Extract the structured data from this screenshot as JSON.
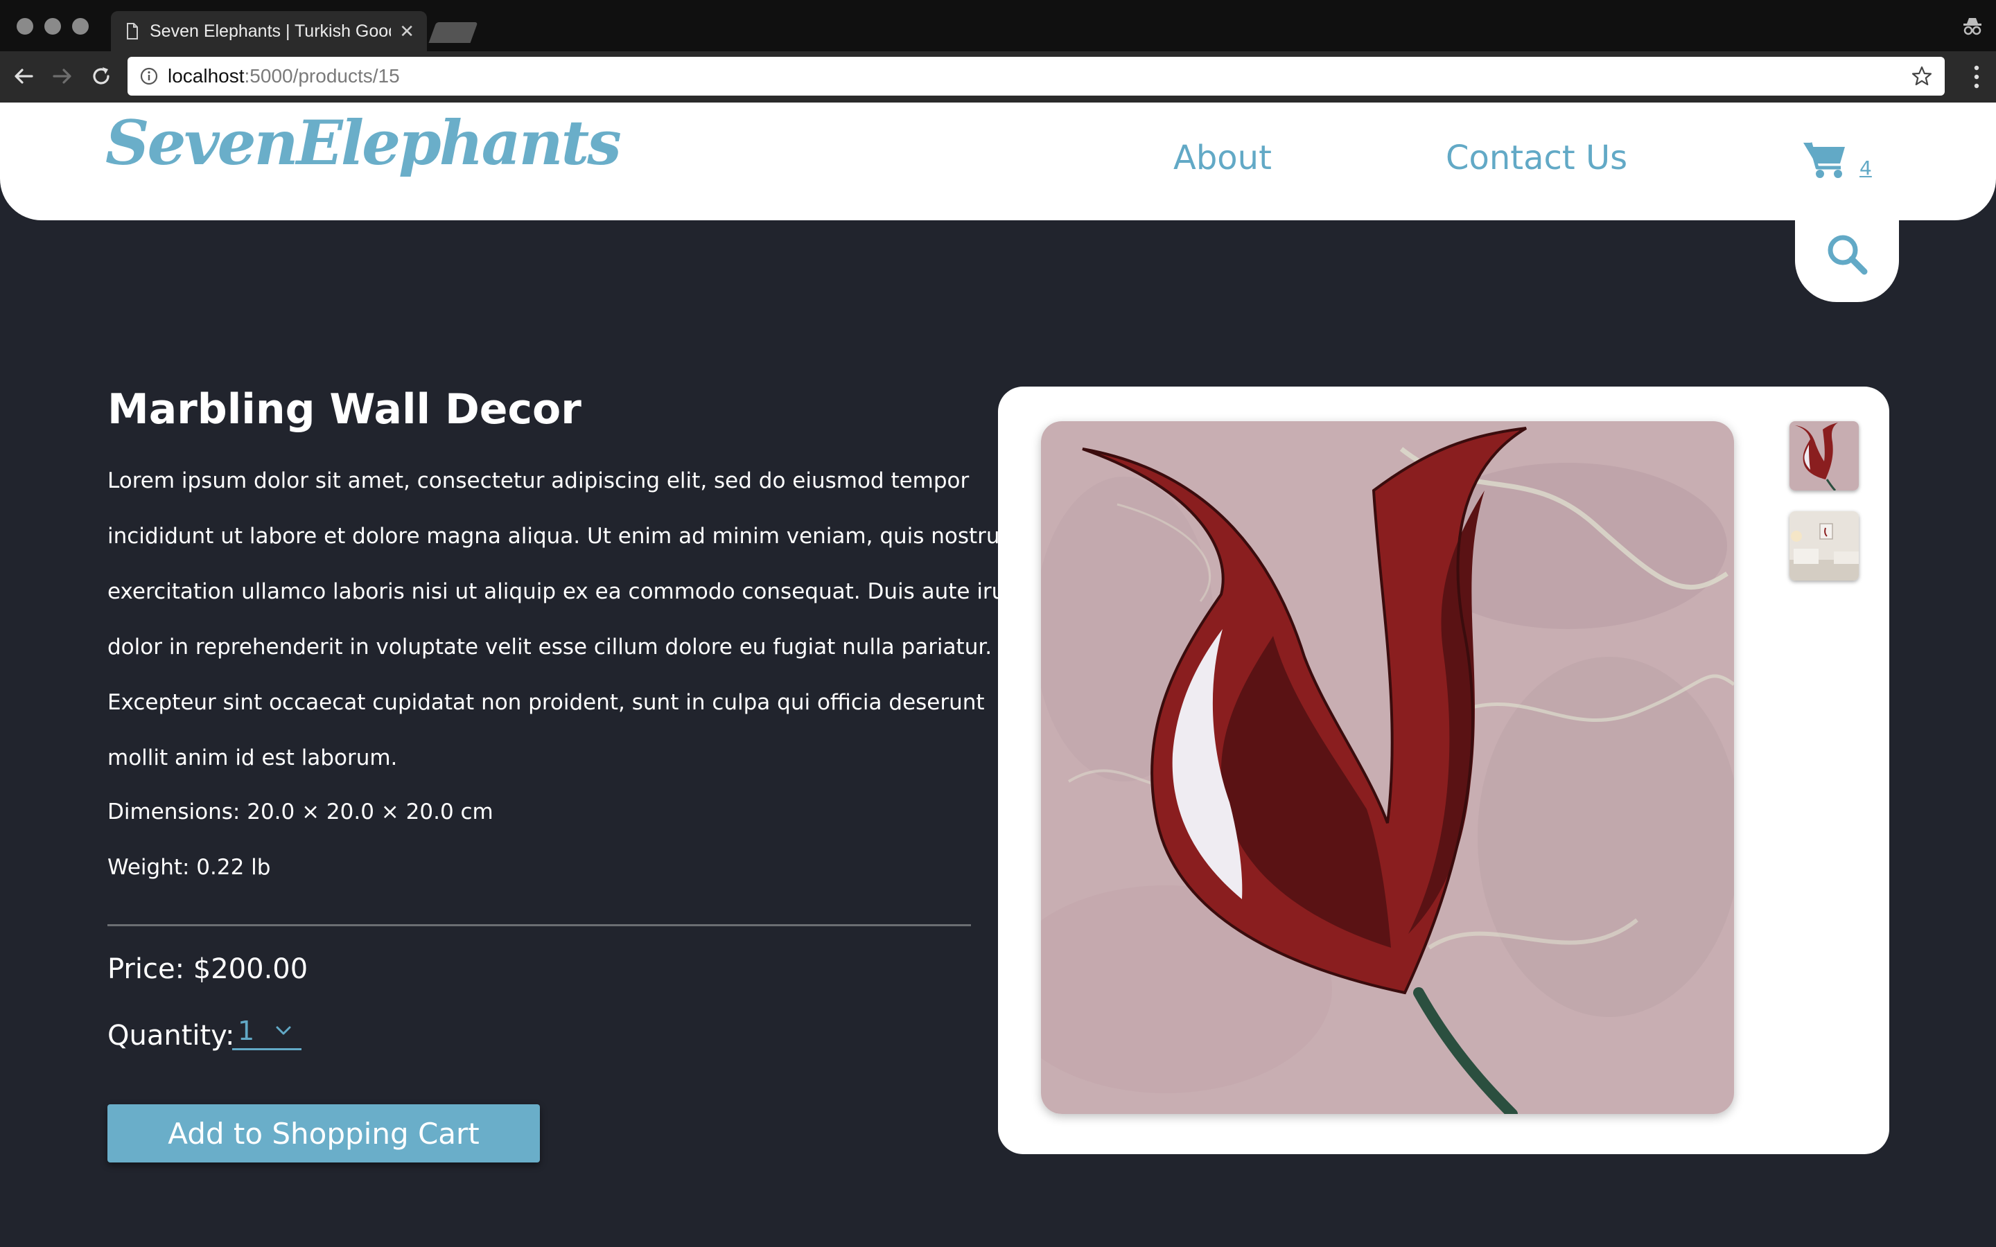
{
  "browser": {
    "tab_title": "Seven Elephants | Turkish Goods",
    "url_host": "localhost",
    "url_path": ":5000/products/15"
  },
  "header": {
    "logo": "SevenElephants",
    "nav": [
      "About",
      "Contact Us"
    ],
    "cart_count": "4"
  },
  "product": {
    "title": "Marbling Wall Decor",
    "description_lines": [
      "Lorem ipsum dolor sit amet, consectetur adipiscing elit, sed do eiusmod tempor",
      "incididunt ut labore et dolore magna aliqua. Ut enim ad minim veniam, quis nostrud",
      "exercitation ullamco laboris nisi ut aliquip ex ea commodo consequat. Duis aute irure",
      "dolor in reprehenderit in voluptate velit esse cillum dolore eu fugiat nulla pariatur.",
      "Excepteur sint occaecat cupidatat non proident, sunt in culpa qui officia deserunt",
      "mollit anim id est laborum."
    ],
    "dimensions": "Dimensions: 20.0 × 20.0 × 20.0 cm",
    "weight": "Weight: 0.22 lb",
    "price": "Price: $200.00",
    "quantity_label": "Quantity:",
    "quantity_value": "1",
    "add_button": "Add to Shopping Cart"
  },
  "colors": {
    "accent": "#6aaec9",
    "background": "#21242d",
    "header": "#ffffff"
  },
  "icons": [
    "page-icon",
    "close-icon",
    "back-icon",
    "forward-icon",
    "reload-icon",
    "info-icon",
    "star-icon",
    "menu-icon",
    "incognito-icon",
    "cart-icon",
    "search-icon",
    "chevron-down-icon"
  ]
}
